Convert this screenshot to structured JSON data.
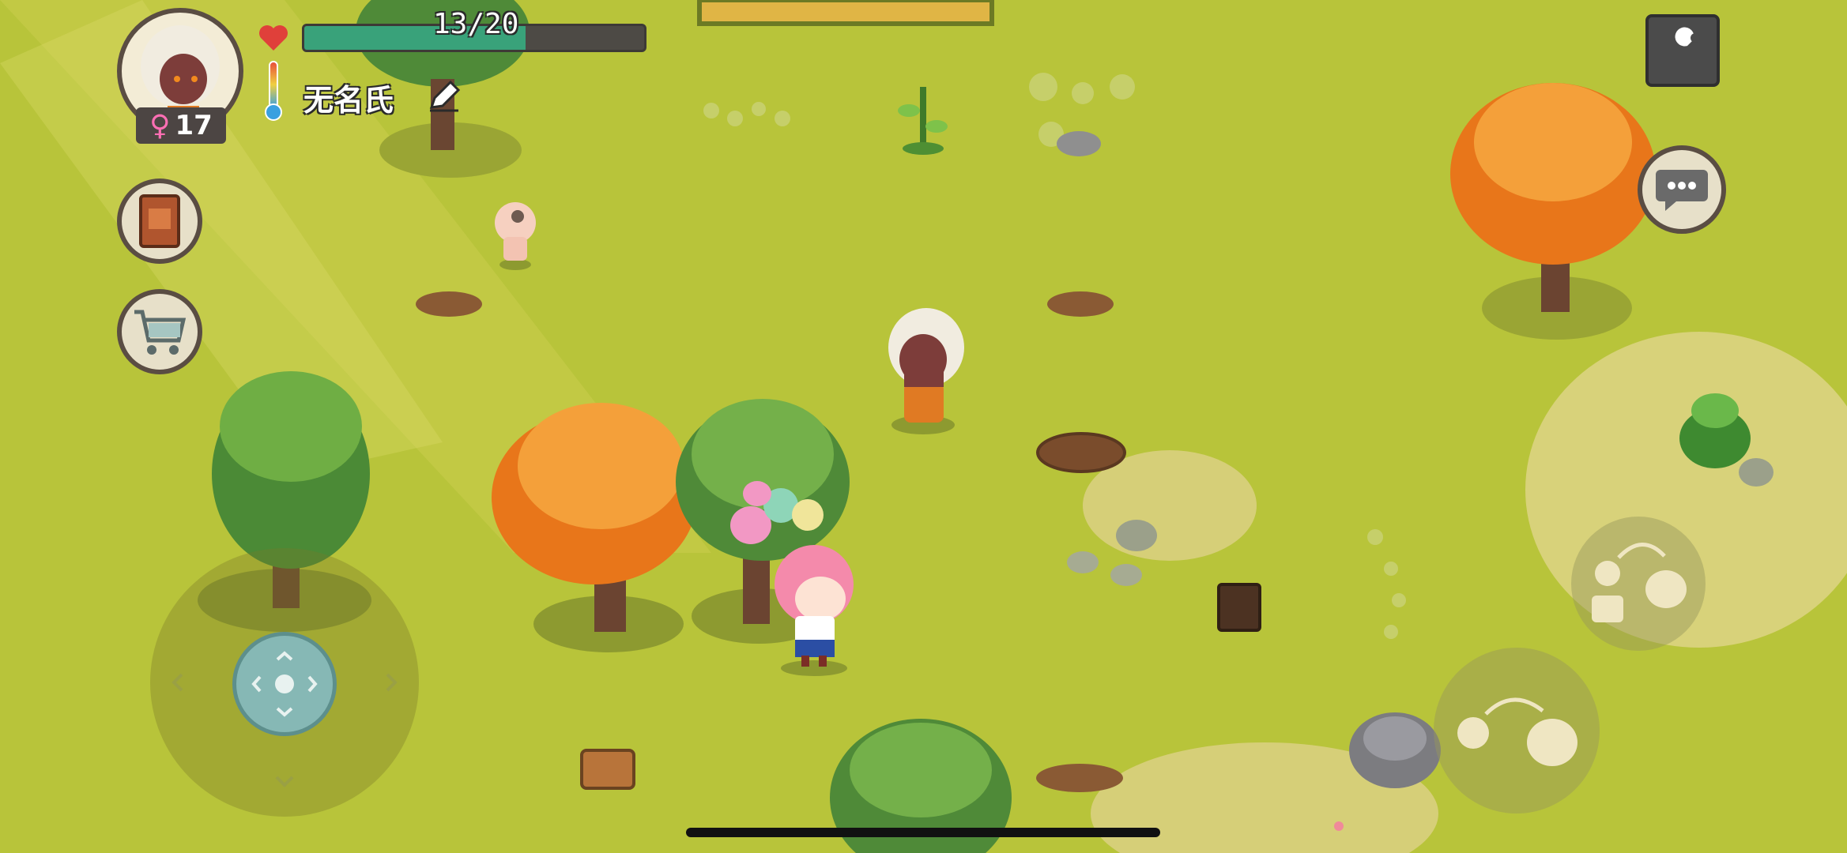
{
  "player": {
    "name": "无名氏",
    "age": "17",
    "gender_icon": "female-symbol",
    "health": {
      "text": "13/20",
      "current": 13,
      "max": 20
    }
  },
  "hud": {
    "left_buttons": [
      {
        "name": "journal-book",
        "icon": "book-icon"
      },
      {
        "name": "shop-cart",
        "icon": "shopping-cart-icon"
      }
    ],
    "right_buttons": [
      {
        "name": "settings",
        "icon": "wrench-icon"
      },
      {
        "name": "chat",
        "icon": "speech-bubble-icon"
      }
    ],
    "action_buttons": [
      {
        "name": "give-item",
        "icon": "give-hand-icon"
      },
      {
        "name": "throw-item",
        "icon": "throw-hand-icon"
      }
    ]
  },
  "colors": {
    "grass": "#b9c63a",
    "health_fill": "#39a27a",
    "autumn_tree": "#f28a1e",
    "green_tree": "#6fa83a"
  }
}
